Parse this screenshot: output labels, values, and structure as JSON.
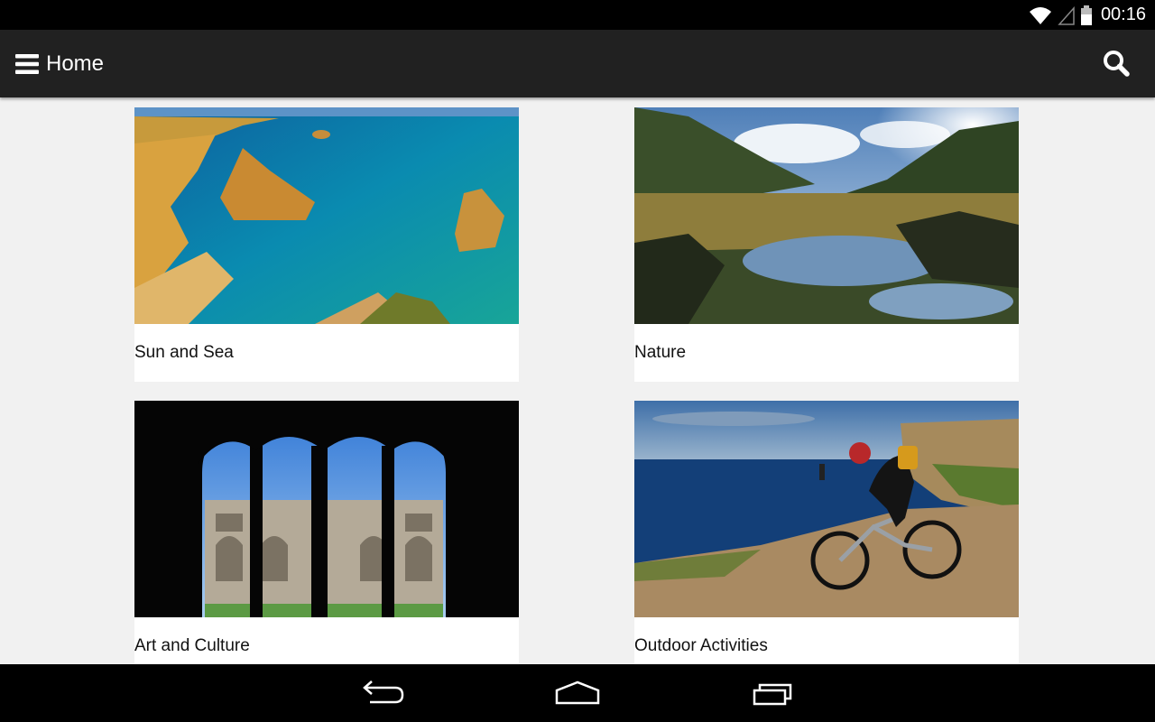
{
  "status_bar": {
    "time": "00:16",
    "icons": [
      "wifi-icon",
      "cell-signal-icon",
      "battery-icon"
    ]
  },
  "app_bar": {
    "title": "Home",
    "menu_icon": "hamburger-menu-icon",
    "search_icon": "search-icon",
    "background": "#212121"
  },
  "cards": [
    {
      "label": "Sun and Sea",
      "image": "coastal-cliffs-photo"
    },
    {
      "label": "Nature",
      "image": "mountain-stream-photo"
    },
    {
      "label": "Art and Culture",
      "image": "cloister-arches-photo"
    },
    {
      "label": "Outdoor Activities",
      "image": "mountain-biker-photo"
    }
  ],
  "nav_bar": {
    "buttons": [
      "back-icon",
      "home-icon",
      "recent-apps-icon"
    ]
  }
}
